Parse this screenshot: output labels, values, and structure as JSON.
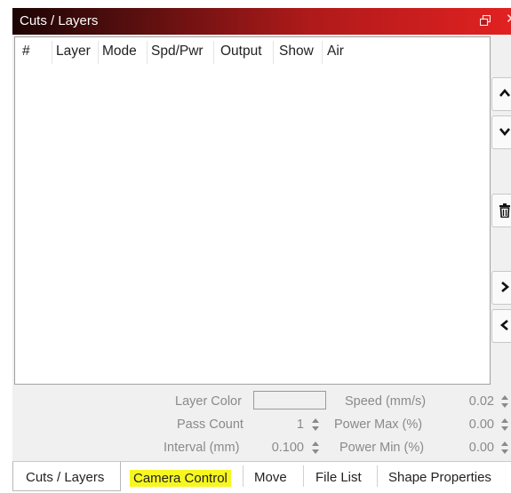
{
  "panel": {
    "title": "Cuts / Layers"
  },
  "table": {
    "columns": [
      "#",
      "Layer",
      "Mode",
      "Spd/Pwr",
      "Output",
      "Show",
      "Air"
    ]
  },
  "properties": {
    "layer_color_label": "Layer Color",
    "pass_count_label": "Pass Count",
    "pass_count_value": "1",
    "interval_label": "Interval (mm)",
    "interval_value": "0.100",
    "speed_label": "Speed (mm/s)",
    "speed_value": "0.02",
    "power_max_label": "Power Max (%)",
    "power_max_value": "0.00",
    "power_min_label": "Power Min (%)",
    "power_min_value": "0.00"
  },
  "tabs": [
    {
      "label": "Cuts / Layers",
      "active": true
    },
    {
      "label": "Camera Control",
      "highlighted": true
    },
    {
      "label": "Move"
    },
    {
      "label": "File List"
    },
    {
      "label": "Shape Properties"
    }
  ],
  "icons": {
    "float": "float-window-icon",
    "close": "close-icon",
    "move_up": "chevron-up-icon",
    "move_down": "chevron-down-icon",
    "delete": "trash-icon",
    "expand": "chevron-right-icon",
    "collapse": "chevron-left-icon"
  },
  "colors": {
    "titlebar_start": "#1c0404",
    "titlebar_end": "#e12121",
    "highlight": "#f7f720"
  }
}
